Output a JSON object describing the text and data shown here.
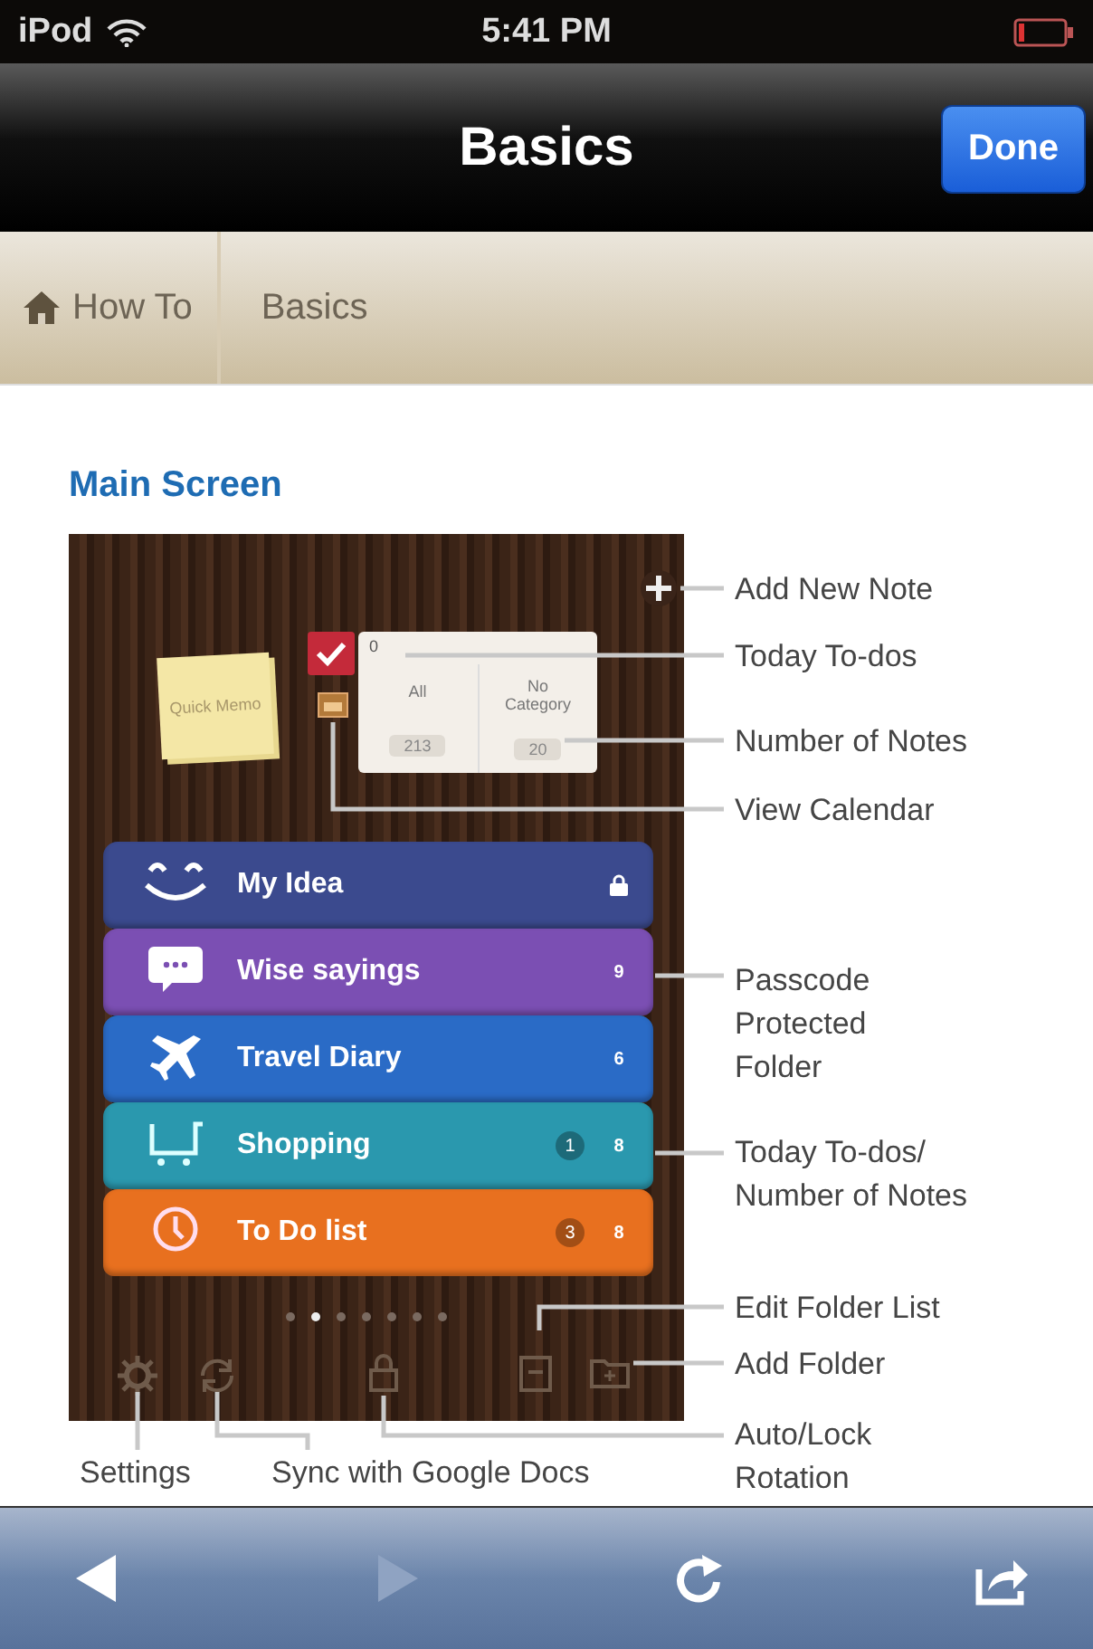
{
  "status_bar": {
    "carrier": "iPod",
    "time": "5:41 PM"
  },
  "nav_bar": {
    "title": "Basics",
    "done_button": "Done"
  },
  "breadcrumb": [
    {
      "label": "How To",
      "kind": "home"
    },
    {
      "label": "Basics",
      "kind": "page"
    }
  ],
  "heading": "Main Screen",
  "app_screenshot": {
    "quick_memo": "Quick Memo",
    "today_todos": "0",
    "summary_columns": [
      {
        "label": "All",
        "count": "213"
      },
      {
        "label": "No Category",
        "count": "20"
      }
    ],
    "folders": [
      {
        "name": "My Idea",
        "kind": "smile",
        "color": "#3b4a8e",
        "locked": true
      },
      {
        "name": "Wise sayings",
        "kind": "speech",
        "color": "#7b4fb3",
        "locked": false,
        "count": "9"
      },
      {
        "name": "Travel Diary",
        "kind": "plane",
        "color": "#2a6bc6",
        "locked": false,
        "count": "6"
      },
      {
        "name": "Shopping",
        "kind": "cart",
        "color": "#2a98ae",
        "locked": false,
        "todos": "1",
        "count": "8"
      },
      {
        "name": "To Do list",
        "kind": "clock",
        "color": "#e8701f",
        "locked": false,
        "todos": "3",
        "count": "8"
      }
    ],
    "page_dots": [
      {
        "selected": false
      },
      {
        "selected": true
      },
      {
        "selected": false
      },
      {
        "selected": false
      },
      {
        "selected": false
      },
      {
        "selected": false
      },
      {
        "selected": false
      }
    ]
  },
  "callouts": [
    {
      "text": "Add New Note"
    },
    {
      "text": "Today To-dos"
    },
    {
      "text": "Number of Notes"
    },
    {
      "text": "View Calendar"
    },
    {
      "text": "Passcode Protected Folder"
    },
    {
      "text": "Today To-dos/ Number of Notes"
    },
    {
      "text": "Edit Folder List"
    },
    {
      "text": "Add Folder"
    },
    {
      "text": "Settings"
    },
    {
      "text": "Sync with Google Docs"
    },
    {
      "text": "Auto/Lock Rotation"
    }
  ],
  "toolbar": [
    {
      "kind": "back",
      "disabled": false
    },
    {
      "kind": "forward",
      "disabled": true
    },
    {
      "kind": "reload",
      "disabled": false
    },
    {
      "kind": "share",
      "disabled": false
    }
  ]
}
